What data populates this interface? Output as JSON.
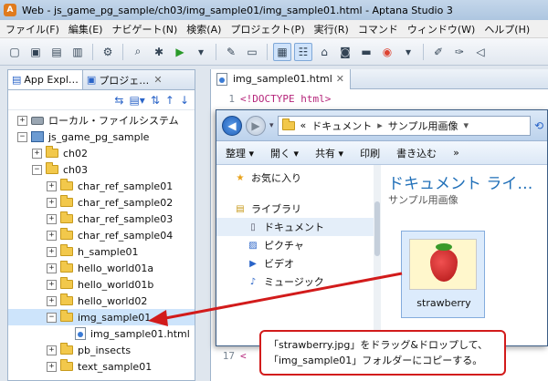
{
  "window": {
    "title": "Web - js_game_pg_sample/ch03/img_sample01/img_sample01.html - Aptana Studio 3"
  },
  "menubar": {
    "items": [
      "ファイル(F)",
      "編集(E)",
      "ナビゲート(N)",
      "検索(A)",
      "プロジェクト(P)",
      "実行(R)",
      "コマンド",
      "ウィンドウ(W)",
      "ヘルプ(H)"
    ]
  },
  "left_panel": {
    "tabs": [
      "App Expl…",
      "プロジェ…"
    ],
    "tree": [
      {
        "label": "ローカル・ファイルシステム",
        "icon": "drive-icon",
        "expander": "+",
        "indent": 0
      },
      {
        "label": "js_game_pg_sample",
        "icon": "project-icon",
        "expander": "−",
        "indent": 0
      },
      {
        "label": "ch02",
        "icon": "folder-icon",
        "expander": "+",
        "indent": 1
      },
      {
        "label": "ch03",
        "icon": "folder-icon",
        "expander": "−",
        "indent": 1
      },
      {
        "label": "char_ref_sample01",
        "icon": "folder-icon",
        "expander": "+",
        "indent": 2
      },
      {
        "label": "char_ref_sample02",
        "icon": "folder-icon",
        "expander": "+",
        "indent": 2
      },
      {
        "label": "char_ref_sample03",
        "icon": "folder-icon",
        "expander": "+",
        "indent": 2
      },
      {
        "label": "char_ref_sample04",
        "icon": "folder-icon",
        "expander": "+",
        "indent": 2
      },
      {
        "label": "h_sample01",
        "icon": "folder-icon",
        "expander": "+",
        "indent": 2
      },
      {
        "label": "hello_world01a",
        "icon": "folder-icon",
        "expander": "+",
        "indent": 2
      },
      {
        "label": "hello_world01b",
        "icon": "folder-icon",
        "expander": "+",
        "indent": 2
      },
      {
        "label": "hello_world02",
        "icon": "folder-icon",
        "expander": "+",
        "indent": 2
      },
      {
        "label": "img_sample01",
        "icon": "folder-icon",
        "expander": "−",
        "indent": 2,
        "selected": true
      },
      {
        "label": "img_sample01.html",
        "icon": "html-file-icon",
        "expander": "",
        "indent": 3
      },
      {
        "label": "pb_insects",
        "icon": "folder-icon",
        "expander": "+",
        "indent": 2
      },
      {
        "label": "text_sample01",
        "icon": "folder-icon",
        "expander": "+",
        "indent": 2
      }
    ]
  },
  "editor": {
    "tab_label": "img_sample01.html",
    "lines": [
      {
        "number": "1",
        "code": "<!DOCTYPE html>"
      },
      {
        "number": "17",
        "code": "<"
      }
    ]
  },
  "explorer": {
    "address": {
      "chevron": "«",
      "segments": [
        "ドキュメント",
        "サンプル用画像"
      ]
    },
    "commands": [
      "整理 ▾",
      "開く ▾",
      "共有 ▾",
      "印刷",
      "書き込む",
      "»"
    ],
    "nav_items": [
      {
        "label": "お気に入り",
        "icon": "star-icon",
        "sub": false,
        "highlight": false
      },
      {
        "label": "ライブラリ",
        "icon": "library-icon",
        "sub": false,
        "highlight": false
      },
      {
        "label": "ドキュメント",
        "icon": "document-icon",
        "sub": true,
        "highlight": true
      },
      {
        "label": "ピクチャ",
        "icon": "picture-icon",
        "sub": true,
        "highlight": false
      },
      {
        "label": "ビデオ",
        "icon": "video-icon",
        "sub": true,
        "highlight": false
      },
      {
        "label": "ミュージック",
        "icon": "music-icon",
        "sub": true,
        "highlight": false
      }
    ],
    "content_title": "ドキュメント ライ…",
    "content_subtitle": "サンプル用画像",
    "file_name": "strawberry"
  },
  "callout": {
    "line1": "「strawberry.jpg」をドラッグ&ドロップして、",
    "line2": "「img_sample01」フォルダーにコピーする。"
  },
  "colors": {
    "accent": "#d21b1b",
    "selection": "#cde4fb",
    "explorer_title": "#1f6fb8"
  }
}
